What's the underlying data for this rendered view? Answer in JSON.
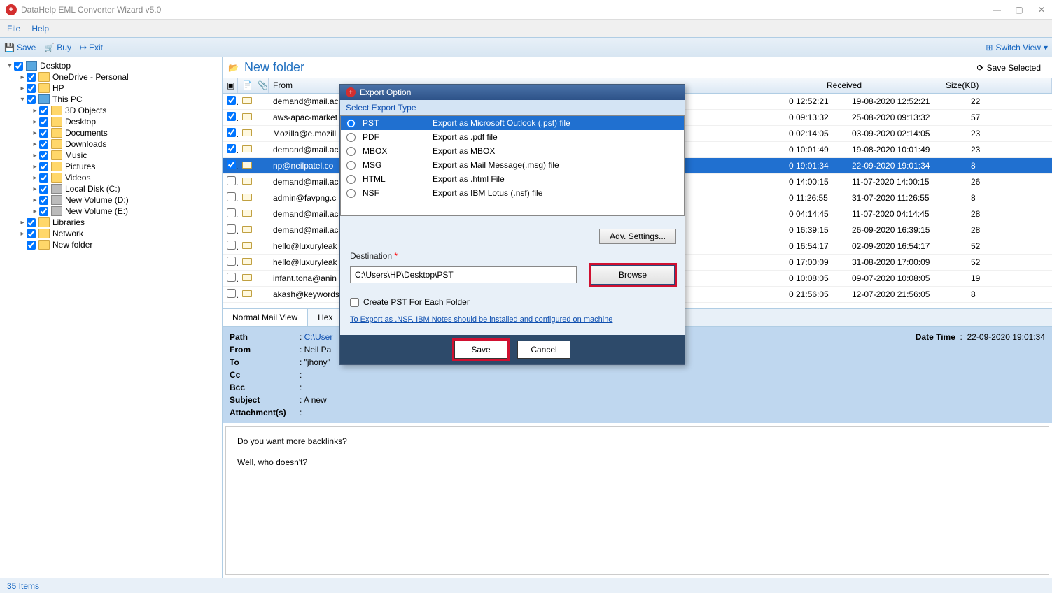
{
  "window": {
    "title": "DataHelp EML Converter Wizard v5.0"
  },
  "menu": {
    "file": "File",
    "help": "Help"
  },
  "toolbar": {
    "save": "Save",
    "buy": "Buy",
    "exit": "Exit",
    "switch_view": "Switch View"
  },
  "tree": [
    {
      "indent": 0,
      "arrow": "▾",
      "check": true,
      "icon": "monitor",
      "label": "Desktop"
    },
    {
      "indent": 1,
      "arrow": "▸",
      "check": true,
      "icon": "cloud",
      "label": "OneDrive - Personal"
    },
    {
      "indent": 1,
      "arrow": "▸",
      "check": true,
      "icon": "user",
      "label": "HP"
    },
    {
      "indent": 1,
      "arrow": "▾",
      "check": true,
      "icon": "monitor",
      "label": "This PC"
    },
    {
      "indent": 2,
      "arrow": "▸",
      "check": true,
      "icon": "folder",
      "label": "3D Objects"
    },
    {
      "indent": 2,
      "arrow": "▸",
      "check": true,
      "icon": "folder",
      "label": "Desktop"
    },
    {
      "indent": 2,
      "arrow": "▸",
      "check": true,
      "icon": "folder",
      "label": "Documents"
    },
    {
      "indent": 2,
      "arrow": "▸",
      "check": true,
      "icon": "folder",
      "label": "Downloads"
    },
    {
      "indent": 2,
      "arrow": "▸",
      "check": true,
      "icon": "folder",
      "label": "Music"
    },
    {
      "indent": 2,
      "arrow": "▸",
      "check": true,
      "icon": "folder",
      "label": "Pictures"
    },
    {
      "indent": 2,
      "arrow": "▸",
      "check": true,
      "icon": "folder",
      "label": "Videos"
    },
    {
      "indent": 2,
      "arrow": "▸",
      "check": true,
      "icon": "drive",
      "label": "Local Disk (C:)"
    },
    {
      "indent": 2,
      "arrow": "▸",
      "check": true,
      "icon": "drive",
      "label": "New Volume (D:)"
    },
    {
      "indent": 2,
      "arrow": "▸",
      "check": true,
      "icon": "drive",
      "label": "New Volume (E:)"
    },
    {
      "indent": 1,
      "arrow": "▸",
      "check": true,
      "icon": "folder",
      "label": "Libraries"
    },
    {
      "indent": 1,
      "arrow": "▸",
      "check": true,
      "icon": "network",
      "label": "Network"
    },
    {
      "indent": 1,
      "arrow": "",
      "check": true,
      "icon": "folder",
      "label": "New folder"
    }
  ],
  "content": {
    "folder_title": "New folder",
    "save_selected": "Save Selected",
    "columns": {
      "from": "From",
      "received": "Received",
      "size": "Size(KB)"
    },
    "rows": [
      {
        "chk": true,
        "from": "demand@mail.ac",
        "d1": "0 12:52:21",
        "recv": "19-08-2020 12:52:21",
        "size": "22",
        "sel": false
      },
      {
        "chk": true,
        "from": "aws-apac-market",
        "d1": "0 09:13:32",
        "recv": "25-08-2020 09:13:32",
        "size": "57",
        "sel": false
      },
      {
        "chk": true,
        "from": "Mozilla@e.mozill",
        "d1": "0 02:14:05",
        "recv": "03-09-2020 02:14:05",
        "size": "23",
        "sel": false
      },
      {
        "chk": true,
        "from": "demand@mail.ac",
        "d1": "0 10:01:49",
        "recv": "19-08-2020 10:01:49",
        "size": "23",
        "sel": false
      },
      {
        "chk": true,
        "from": "np@neilpatel.co",
        "d1": "0 19:01:34",
        "recv": "22-09-2020 19:01:34",
        "size": "8",
        "sel": true
      },
      {
        "chk": false,
        "from": "demand@mail.ac",
        "d1": "0 14:00:15",
        "recv": "11-07-2020 14:00:15",
        "size": "26",
        "sel": false
      },
      {
        "chk": false,
        "from": "admin@favpng.c",
        "d1": "0 11:26:55",
        "recv": "31-07-2020 11:26:55",
        "size": "8",
        "sel": false
      },
      {
        "chk": false,
        "from": "demand@mail.ac",
        "d1": "0 04:14:45",
        "recv": "11-07-2020 04:14:45",
        "size": "28",
        "sel": false
      },
      {
        "chk": false,
        "from": "demand@mail.ac",
        "d1": "0 16:39:15",
        "recv": "26-09-2020 16:39:15",
        "size": "28",
        "sel": false
      },
      {
        "chk": false,
        "from": "hello@luxuryleak",
        "d1": "0 16:54:17",
        "recv": "02-09-2020 16:54:17",
        "size": "52",
        "sel": false
      },
      {
        "chk": false,
        "from": "hello@luxuryleak",
        "d1": "0 17:00:09",
        "recv": "31-08-2020 17:00:09",
        "size": "52",
        "sel": false
      },
      {
        "chk": false,
        "from": "infant.tona@anin",
        "d1": "0 10:08:05",
        "recv": "09-07-2020 10:08:05",
        "size": "19",
        "sel": false
      },
      {
        "chk": false,
        "from": "akash@keywords",
        "d1": "0 21:56:05",
        "recv": "12-07-2020 21:56:05",
        "size": "8",
        "sel": false
      }
    ]
  },
  "view_tabs": {
    "normal": "Normal Mail View",
    "hex": "Hex"
  },
  "detail": {
    "path_label": "Path",
    "path_val": "C:\\User",
    "from_label": "From",
    "from_val": "Neil Pa",
    "to_label": "To",
    "to_val": "\"jhony\"",
    "cc_label": "Cc",
    "cc_val": "",
    "bcc_label": "Bcc",
    "bcc_val": "",
    "subject_label": "Subject",
    "subject_val": "A new",
    "att_label": "Attachment(s)",
    "att_val": "",
    "datetime_label": "Date Time",
    "datetime_val": "22-09-2020 19:01:34"
  },
  "body": {
    "p1": "Do you want more backlinks?",
    "p2": "Well, who doesn't?"
  },
  "status": "35 Items",
  "dialog": {
    "title": "Export Option",
    "section": "Select Export Type",
    "options": [
      {
        "name": "PST",
        "desc": "Export as Microsoft Outlook (.pst) file",
        "sel": true
      },
      {
        "name": "PDF",
        "desc": "Export as .pdf file",
        "sel": false
      },
      {
        "name": "MBOX",
        "desc": "Export as MBOX",
        "sel": false
      },
      {
        "name": "MSG",
        "desc": "Export as Mail Message(.msg) file",
        "sel": false
      },
      {
        "name": "HTML",
        "desc": "Export as .html File",
        "sel": false
      },
      {
        "name": "NSF",
        "desc": "Export as IBM Lotus (.nsf) file",
        "sel": false
      }
    ],
    "adv": "Adv. Settings...",
    "dest_label": "Destination",
    "dest_val": "C:\\Users\\HP\\Desktop\\PST",
    "browse": "Browse",
    "create_pst": "Create PST For Each Folder",
    "note": "To Export as .NSF, IBM Notes should be installed and configured on machine",
    "save": "Save",
    "cancel": "Cancel"
  }
}
